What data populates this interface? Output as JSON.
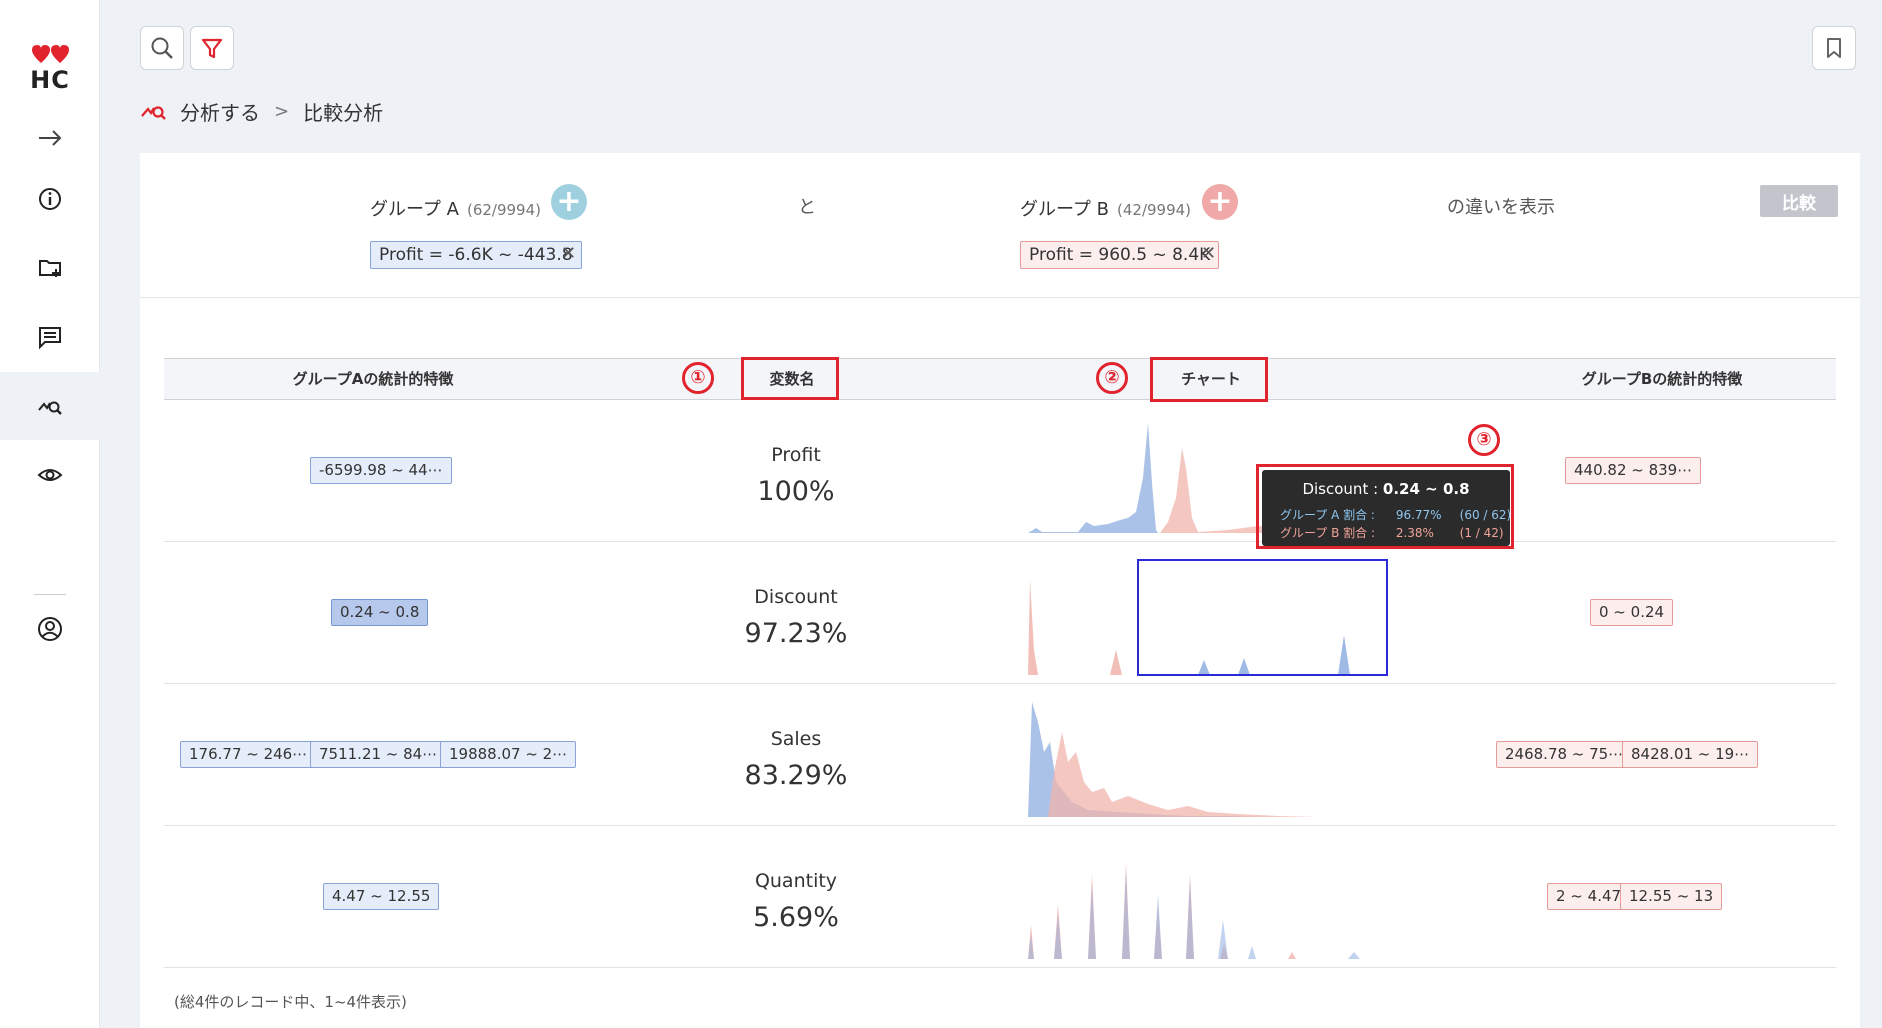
{
  "app": {
    "logo_text": "HC"
  },
  "sidebar": {
    "items": [
      {
        "name": "expand-arrow-icon"
      },
      {
        "name": "info-icon"
      },
      {
        "name": "folder-add-icon"
      },
      {
        "name": "comment-icon"
      },
      {
        "name": "analysis-icon",
        "active": true
      },
      {
        "name": "eye-icon"
      },
      {
        "name": "user-circle-icon"
      }
    ]
  },
  "toolbar": {
    "search_icon": "search-icon",
    "filter_icon": "filter-icon",
    "bookmark_icon": "bookmark-icon"
  },
  "breadcrumb": {
    "parent": "分析する",
    "separator": ">",
    "current": "比較分析"
  },
  "groups": {
    "a": {
      "label": "グループ A",
      "count": "(62/9994)",
      "filter": "Profit = -6.6K ~ -443.8",
      "color": "#9fd0e0"
    },
    "connector": "と",
    "b": {
      "label": "グループ B",
      "count": "(42/9994)",
      "filter": "Profit = 960.5 ~ 8.4K",
      "color": "#f0a8a8"
    },
    "suffix": "の違いを表示",
    "compare_button": "比較",
    "remove": "✕"
  },
  "table": {
    "headers": {
      "group_a_stats": "グループAの統計的特徴",
      "variable": "変数名",
      "chart": "チャート",
      "group_b_stats": "グループBの統計的特徴"
    },
    "annotations": [
      "①",
      "②",
      "③"
    ],
    "rows": [
      {
        "variable": "Profit",
        "percent": "100%",
        "a_ranges": [
          "-6599.98 ~ 44⋯"
        ],
        "b_ranges": [
          "440.82 ~ 839⋯"
        ]
      },
      {
        "variable": "Discount",
        "percent": "97.23%",
        "a_ranges": [
          "0.24 ~ 0.8"
        ],
        "b_ranges": [
          "0 ~ 0.24"
        ]
      },
      {
        "variable": "Sales",
        "percent": "83.29%",
        "a_ranges": [
          "176.77 ~ 246⋯",
          "7511.21 ~ 84⋯",
          "19888.07 ~ 2⋯"
        ],
        "b_ranges": [
          "2468.78 ~ 75⋯",
          "8428.01 ~ 19⋯"
        ]
      },
      {
        "variable": "Quantity",
        "percent": "5.69%",
        "a_ranges": [
          "4.47 ~ 12.55"
        ],
        "b_ranges": [
          "2 ~ 4.47",
          "12.55 ~ 13"
        ]
      }
    ]
  },
  "tooltip": {
    "title_key": "Discount : ",
    "title_value": "0.24 ~ 0.8",
    "a_label": "グループ A 割合 :",
    "a_pct": "96.77%",
    "a_frac": "(60 / 62)",
    "b_label": "グループ B 割合 :",
    "b_pct": "2.38%",
    "b_frac": "(1 / 42)"
  },
  "footer": "(総4件のレコード中、1~4件表示)",
  "colors": {
    "group_a": "#8eaee0",
    "group_b": "#f0b4ac",
    "accent_red": "#e0232d",
    "selection": "#2b2bd6"
  }
}
